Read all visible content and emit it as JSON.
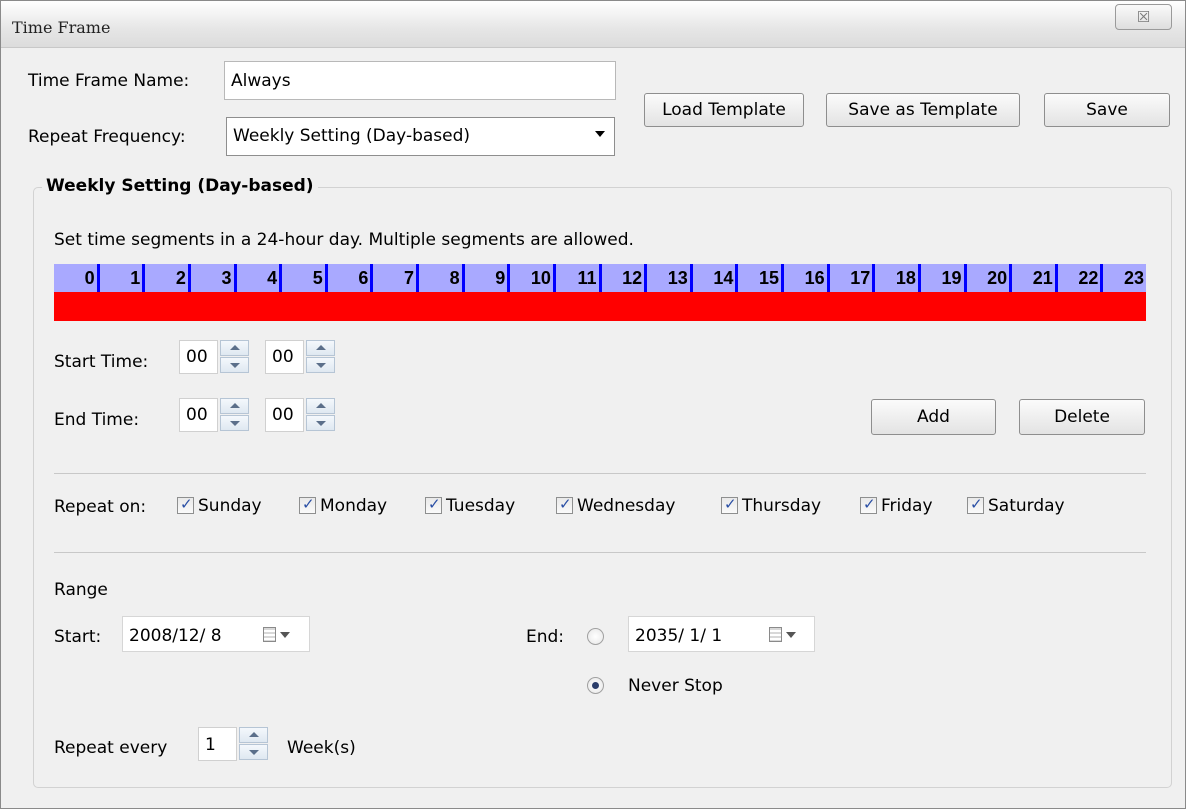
{
  "window": {
    "title": "Time Frame",
    "close_glyph": "☒"
  },
  "form": {
    "name_label": "Time Frame Name:",
    "name_value": "Always",
    "freq_label": "Repeat Frequency:",
    "freq_value": "Weekly Setting (Day-based)"
  },
  "buttons": {
    "load_template": "Load Template",
    "save_as_template": "Save as Template",
    "save": "Save",
    "add": "Add",
    "delete": "Delete"
  },
  "weekly": {
    "legend": "Weekly Setting (Day-based)",
    "instruction": "Set time segments in a 24-hour day. Multiple segments are allowed.",
    "hours": [
      "0",
      "1",
      "2",
      "3",
      "4",
      "5",
      "6",
      "7",
      "8",
      "9",
      "10",
      "11",
      "12",
      "13",
      "14",
      "15",
      "16",
      "17",
      "18",
      "19",
      "20",
      "21",
      "22",
      "23"
    ],
    "segment_color": "#ff0000",
    "hour_bg": "#a9a9ff",
    "start_label": "Start Time:",
    "start_hour": "00",
    "start_min": "00",
    "end_label": "End Time:",
    "end_hour": "00",
    "end_min": "00",
    "repeat_on_label": "Repeat on:",
    "days": [
      {
        "label": "Sunday",
        "checked": true
      },
      {
        "label": "Monday",
        "checked": true
      },
      {
        "label": "Tuesday",
        "checked": true
      },
      {
        "label": "Wednesday",
        "checked": true
      },
      {
        "label": "Thursday",
        "checked": true
      },
      {
        "label": "Friday",
        "checked": true
      },
      {
        "label": "Saturday",
        "checked": true
      }
    ]
  },
  "range": {
    "title": "Range",
    "start_label": "Start:",
    "start_date": "2008/12/ 8",
    "end_label": "End:",
    "end_date": "2035/ 1/ 1",
    "end_date_selected": false,
    "never_stop_label": "Never Stop",
    "never_stop_selected": true,
    "repeat_every_label": "Repeat every",
    "repeat_every_value": "1",
    "repeat_unit": "Week(s)"
  }
}
